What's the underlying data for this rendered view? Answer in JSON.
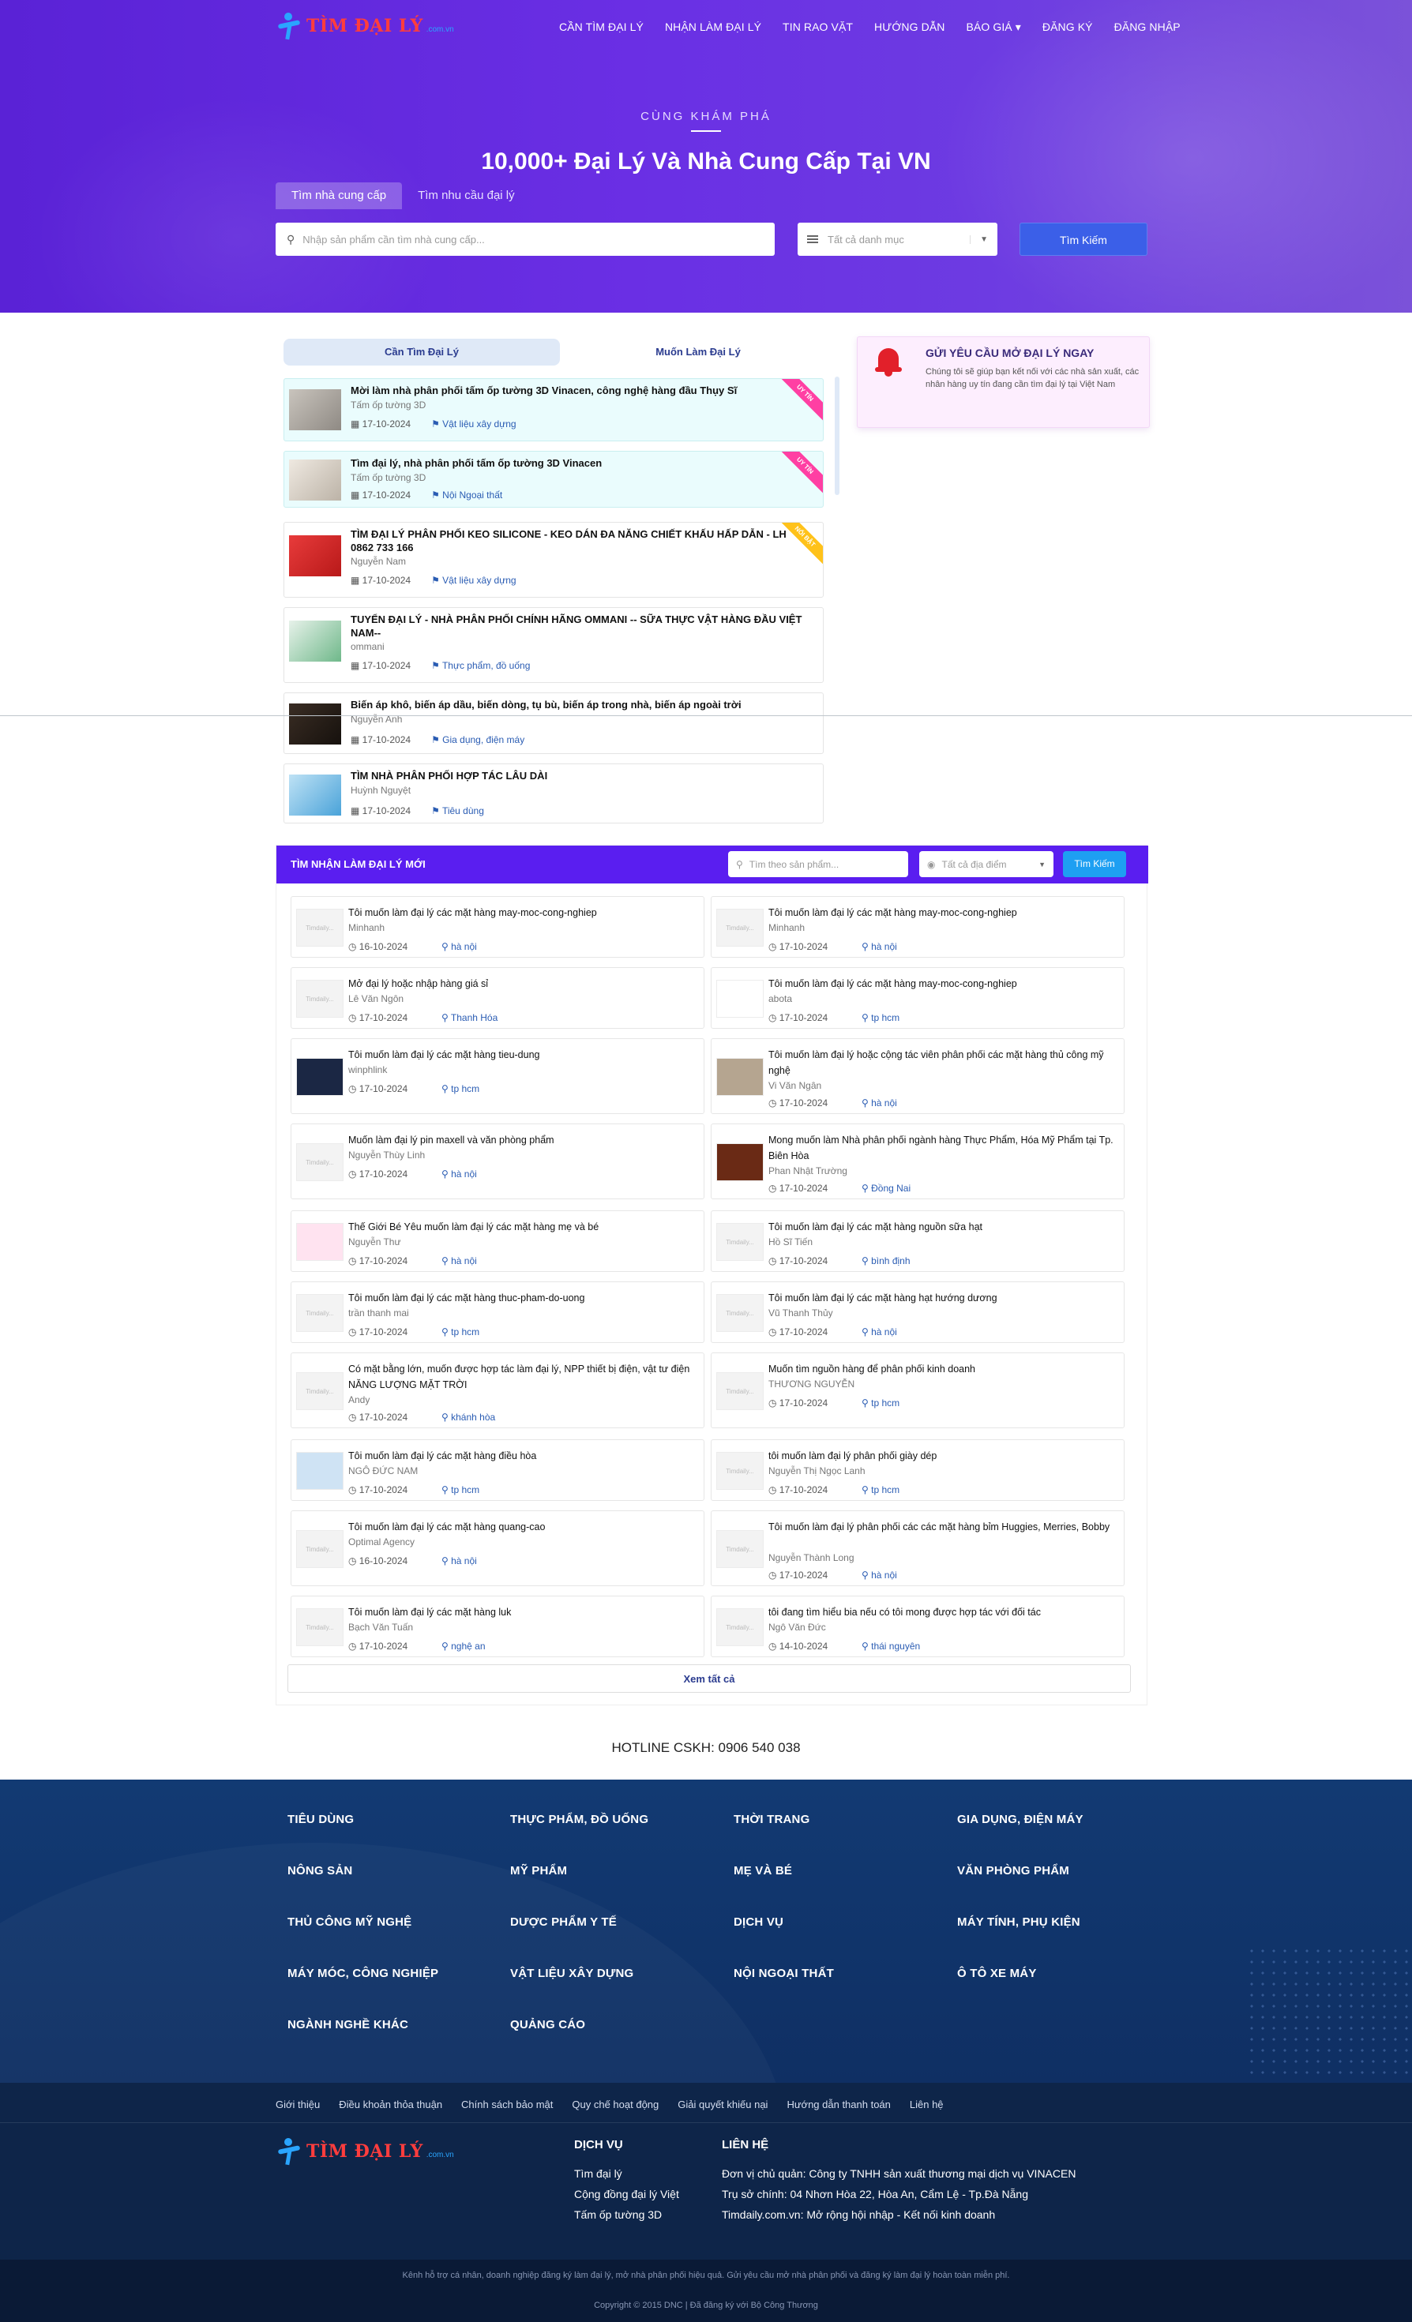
{
  "header": {
    "logo_text": "TÌM ĐẠI LÝ",
    "logo_suffix": ".com.vn",
    "nav": [
      "CẦN TÌM ĐẠI LÝ",
      "NHẬN LÀM ĐẠI LÝ",
      "TIN RAO VẶT",
      "HƯỚNG DẪN",
      "BÁO GIÁ ▾",
      "ĐĂNG KÝ",
      "ĐĂNG NHẬP"
    ]
  },
  "hero": {
    "kicker": "CÙNG KHÁM PHÁ",
    "title": "10,000+ Đại Lý Và Nhà Cung Cấp Tại VN",
    "tab_supplier": "Tìm nhà cung cấp",
    "tab_demand": "Tìm nhu cầu đại lý",
    "search_placeholder": "Nhập sản phẩm cần tìm nhà cung cấp...",
    "category_placeholder": "Tất cả danh mục",
    "search_button": "Tìm Kiếm"
  },
  "listing": {
    "tab_find": "Cần Tìm Đại Lý",
    "tab_become": "Muốn Làm Đại Lý",
    "items": [
      {
        "title": "Mời làm nhà phân phối tấm ốp tường 3D Vinacen, công nghệ hàng đầu Thụy Sĩ",
        "sub": "Tấm ốp tường 3D",
        "date": "17-10-2024",
        "tag": "Vật liệu xây dựng",
        "badge": "UY TÍN"
      },
      {
        "title": "Tìm đại lý, nhà phân phối tấm ốp tường 3D Vinacen",
        "sub": "Tấm ốp tường 3D",
        "date": "17-10-2024",
        "tag": "Nội Ngoại thất",
        "badge": "UY TÍN"
      },
      {
        "title": "TÌM ĐẠI LÝ PHÂN PHỐI KEO SILICONE - KEO DÁN ĐA NĂNG CHIẾT KHẤU HẤP DẪN - LH 0862 733 166",
        "sub": "Nguyễn Nam",
        "date": "17-10-2024",
        "tag": "Vật liệu xây dựng",
        "badge": "NỔI BẬT"
      },
      {
        "title": "TUYỂN ĐẠI LÝ - NHÀ PHÂN PHỐI CHÍNH HÃNG OMMANI -- SỮA THỰC VẬT HÀNG ĐẦU VIỆT NAM--",
        "sub": "ommani",
        "date": "17-10-2024",
        "tag": "Thực phẩm, đồ uống",
        "badge": ""
      },
      {
        "title": "Biến áp khô, biến áp dầu, biến dòng, tụ bù, biến áp trong nhà, biến áp ngoài trời",
        "sub": "Nguyễn Anh",
        "date": "17-10-2024",
        "tag": "Gia dụng, điện máy",
        "badge": ""
      },
      {
        "title": "TÌM NHÀ PHÂN PHỐI HỢP TÁC LÂU DÀI",
        "sub": "Huỳnh Nguyệt",
        "date": "17-10-2024",
        "tag": "Tiêu dùng",
        "badge": ""
      }
    ]
  },
  "alert": {
    "title": "GỬI YÊU CẦU MỞ ĐẠI LÝ NGAY",
    "desc": "Chúng tôi sẽ giúp bạn kết nối với các nhà sản xuất, các nhân hàng uy tín đang cần tìm đại lý tại Việt Nam"
  },
  "new_agents": {
    "title": "TÌM NHẬN LÀM ĐẠI LÝ MỚI",
    "search_placeholder": "Tìm theo sản phẩm...",
    "location_placeholder": "Tất cả địa điểm",
    "search_button": "Tìm Kiếm",
    "placeholder_img": "Timdaily...",
    "more": "Xem tất cả",
    "cards": [
      {
        "title": "Tôi muốn làm đại lý các mặt hàng may-moc-cong-nghiep",
        "name": "Minhanh",
        "date": "16-10-2024",
        "loc": "hà nội"
      },
      {
        "title": "Tôi muốn làm đại lý các mặt hàng may-moc-cong-nghiep",
        "name": "Minhanh",
        "date": "17-10-2024",
        "loc": "hà nội"
      },
      {
        "title": "Mở đại lý hoặc nhập hàng giá sỉ",
        "name": "Lê Văn Ngôn",
        "date": "17-10-2024",
        "loc": "Thanh Hóa"
      },
      {
        "title": "Tôi muốn làm đại lý các mặt hàng may-moc-cong-nghiep",
        "name": "abota",
        "date": "17-10-2024",
        "loc": "tp hcm"
      },
      {
        "title": "Tôi muốn làm đại lý các mặt hàng tieu-dung",
        "name": "winphlink",
        "date": "17-10-2024",
        "loc": "tp hcm"
      },
      {
        "title": "Tôi muốn làm đại lý hoặc cộng tác viên phân phối các mặt hàng thủ công mỹ nghệ",
        "name": "Vi Văn Ngân",
        "date": "17-10-2024",
        "loc": "hà nội"
      },
      {
        "title": "Muốn làm đại lý pin maxell và văn phòng phẩm",
        "name": "Nguyễn Thùy Linh",
        "date": "17-10-2024",
        "loc": "hà nội"
      },
      {
        "title": "Mong muốn làm Nhà phân phối ngành hàng Thực Phẩm, Hóa Mỹ Phẩm tại Tp. Biên Hòa",
        "name": "Phan Nhật Trường",
        "date": "17-10-2024",
        "loc": "Đồng Nai"
      },
      {
        "title": "Thế Giới Bé Yêu muốn làm đại lý các mặt hàng mẹ và bé",
        "name": "Nguyễn Thư",
        "date": "17-10-2024",
        "loc": "hà nội"
      },
      {
        "title": "Tôi muốn làm đại lý các mặt hàng nguồn sữa hạt",
        "name": "Hồ Sĩ Tiến",
        "date": "17-10-2024",
        "loc": "bình định"
      },
      {
        "title": "Tôi muốn làm đại lý các mặt hàng thuc-pham-do-uong",
        "name": "trần thanh mai",
        "date": "17-10-2024",
        "loc": "tp hcm"
      },
      {
        "title": "Tôi muốn làm đại lý các mặt hàng hạt hướng dương",
        "name": "Vũ Thanh Thủy",
        "date": "17-10-2024",
        "loc": "hà nội"
      },
      {
        "title": "Có mặt bằng lớn, muốn được hợp tác làm đại lý, NPP thiết bị điện, vật tư điện NĂNG LƯỢNG MẶT TRỜI",
        "name": "Andy",
        "date": "17-10-2024",
        "loc": "khánh hòa"
      },
      {
        "title": "Muốn tìm nguồn hàng để phân phối kinh doanh",
        "name": "THƯƠNG NGUYỄN",
        "date": "17-10-2024",
        "loc": "tp hcm"
      },
      {
        "title": "Tôi muốn làm đại lý các mặt hàng điều hòa",
        "name": "NGÔ ĐỨC NAM",
        "date": "17-10-2024",
        "loc": "tp hcm"
      },
      {
        "title": "tôi muốn làm đại lý phân phối giày dép",
        "name": "Nguyễn Thị Ngọc Lanh",
        "date": "17-10-2024",
        "loc": "tp hcm"
      },
      {
        "title": "Tôi muốn làm đại lý các mặt hàng quang-cao",
        "name": "Optimal Agency",
        "date": "16-10-2024",
        "loc": "hà nội"
      },
      {
        "title": "Tôi muốn làm đại lý phân phối các các mặt hàng bỉm Huggies, Merries, Bobby",
        "name": "Nguyễn Thành Long",
        "date": "17-10-2024",
        "loc": "hà nội"
      },
      {
        "title": "Tôi muốn làm đại lý các mặt hàng luk",
        "name": "Bạch Văn Tuấn",
        "date": "17-10-2024",
        "loc": "nghệ an"
      },
      {
        "title": "tôi đang tìm hiểu bia nếu có tôi mong được hợp tác với đối tác",
        "name": "Ngô Văn Đức",
        "date": "14-10-2024",
        "loc": "thái nguyên"
      }
    ]
  },
  "hotline": "HOTLINE CSKH: 0906 540 038",
  "footer": {
    "categories": [
      "TIÊU DÙNG",
      "THỰC PHẨM, ĐỒ UỐNG",
      "THỜI TRANG",
      "GIA DỤNG, ĐIỆN MÁY",
      "NÔNG SẢN",
      "MỸ PHẨM",
      "MẸ VÀ BÉ",
      "VĂN PHÒNG PHẨM",
      "THỦ CÔNG MỸ NGHỆ",
      "DƯỢC PHẨM Y TẾ",
      "DỊCH VỤ",
      "MÁY TÍNH, PHỤ KIỆN",
      "MÁY MÓC, CÔNG NGHIỆP",
      "VẬT LIỆU XÂY DỰNG",
      "NỘI NGOẠI THẤT",
      "Ô TÔ XE MÁY",
      "NGÀNH NGHỀ KHÁC",
      "QUẢNG CÁO"
    ],
    "links": [
      "Giới thiệu",
      "Điều khoản thỏa thuận",
      "Chính sách bảo mật",
      "Quy chế hoạt động",
      "Giải quyết khiếu nại",
      "Hướng dẫn thanh toán",
      "Liên hệ"
    ],
    "service_title": "DỊCH VỤ",
    "services": [
      "Tìm đại lý",
      "Cộng đồng đại lý Việt",
      "Tấm ốp tường 3D"
    ],
    "contact_title": "LIÊN HỆ",
    "contacts": [
      "Đơn vị chủ quản: Công ty TNHH sản xuất thương mại dịch vụ VINACEN",
      "Trụ sở chính: 04 Nhơn Hòa 22, Hòa An, Cẩm Lệ - Tp.Đà Nẵng",
      "Timdaily.com.vn: Mở rộng hội nhập - Kết nối kinh doanh"
    ],
    "tagline": "Kênh hỗ trợ cá nhân, doanh nghiệp đăng ký làm đại lý, mở nhà phân phối hiệu quả. Gửi yêu cầu mở nhà phân phối và đăng ký làm đại lý hoàn toàn miễn phí.",
    "copyright": "Copyright © 2015 DNC | Đã đăng ký với Bộ Công Thương"
  },
  "colors": {
    "hero": "#5a22d6",
    "accent": "#3b5fe8",
    "bar": "#5a1ef0",
    "footer": "#123a73",
    "ribbon_pink": "#ff3fa3",
    "ribbon_yellow": "#ffc21a"
  }
}
